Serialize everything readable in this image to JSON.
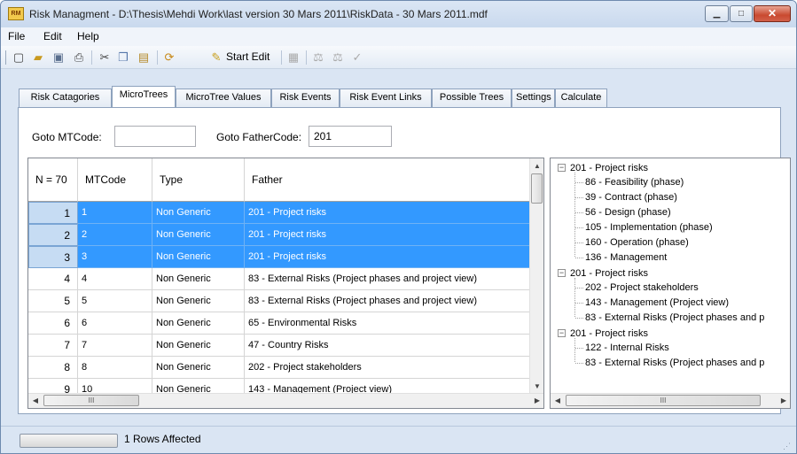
{
  "window": {
    "title": "Risk Managment - D:\\Thesis\\Mehdi Work\\last version 30 Mars 2011\\RiskData - 30 Mars 2011.mdf",
    "minimize": "▁",
    "maximize": "□",
    "close": "✕"
  },
  "menu": [
    "File",
    "Edit",
    "Help"
  ],
  "toolbar": {
    "start_edit": "Start Edit",
    "icons": [
      "new-icon",
      "open-icon",
      "save-icon",
      "print-icon",
      "cut-icon",
      "copy-icon",
      "paste-icon",
      "refresh-icon",
      "pencil-icon",
      "grid-icon",
      "scale-icon",
      "scale-icon",
      "check-icon"
    ]
  },
  "tabs": [
    "Risk Catagories",
    "MicroTrees",
    "MicroTree Values",
    "Risk Events",
    "Risk Event Links",
    "Possible Trees",
    "Settings",
    "Calculate"
  ],
  "active_tab": "MicroTrees",
  "goto": {
    "mtcode_label": "Goto MTCode:",
    "mtcode_value": "",
    "fathercode_label": "Goto FatherCode:",
    "fathercode_value": "201"
  },
  "grid": {
    "columns": [
      "N = 70",
      "MTCode",
      "Type",
      "Father"
    ],
    "rows": [
      {
        "n": "1",
        "mtcode": "1",
        "type": "Non Generic",
        "father": "201 - Project risks",
        "selected": true
      },
      {
        "n": "2",
        "mtcode": "2",
        "type": "Non Generic",
        "father": "201 - Project risks",
        "selected": true
      },
      {
        "n": "3",
        "mtcode": "3",
        "type": "Non Generic",
        "father": "201 - Project risks",
        "selected": true
      },
      {
        "n": "4",
        "mtcode": "4",
        "type": "Non Generic",
        "father": "83 - External Risks (Project phases and  project view)",
        "selected": false
      },
      {
        "n": "5",
        "mtcode": "5",
        "type": "Non Generic",
        "father": "83 - External Risks (Project phases and  project view)",
        "selected": false
      },
      {
        "n": "6",
        "mtcode": "6",
        "type": "Non Generic",
        "father": "65 - Environmental Risks",
        "selected": false
      },
      {
        "n": "7",
        "mtcode": "7",
        "type": "Non Generic",
        "father": "47 - Country Risks",
        "selected": false
      },
      {
        "n": "8",
        "mtcode": "8",
        "type": "Non Generic",
        "father": "202 - Project stakeholders",
        "selected": false
      },
      {
        "n": "9",
        "mtcode": "10",
        "type": "Non Generic",
        "father": "143 - Management (Project view)",
        "selected": false
      }
    ]
  },
  "tree": [
    {
      "label": "201 - Project risks",
      "expanded": true,
      "children": [
        "86 - Feasibility (phase)",
        "39 - Contract (phase)",
        "56 - Design (phase)",
        "105 - Implementation (phase)",
        "160 - Operation (phase)",
        "136 - Management"
      ]
    },
    {
      "label": "201 - Project risks",
      "expanded": true,
      "children": [
        "202 - Project stakeholders",
        "143 - Management (Project view)",
        "83 - External Risks (Project phases and  p"
      ]
    },
    {
      "label": "201 - Project risks",
      "expanded": true,
      "children": [
        "122 - Internal Risks",
        "83 - External Risks (Project phases and  p"
      ]
    }
  ],
  "scroll_glyphs": {
    "up": "▲",
    "down": "▼",
    "left": "◀",
    "right": "▶",
    "grip": "III",
    "expanded": "−"
  },
  "status": {
    "text": "1 Rows Affected",
    "grip": "⋰"
  }
}
